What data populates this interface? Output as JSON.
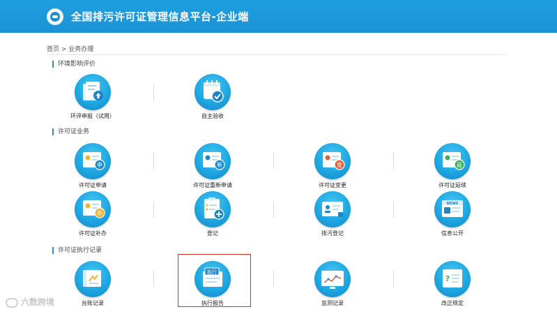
{
  "header": {
    "title": "全国排污许可证管理信息平台-企业端"
  },
  "breadcrumb": {
    "home": "首页",
    "sep": " > ",
    "current": "业务办理"
  },
  "sections": [
    {
      "title": "环境影响评价"
    },
    {
      "title": "许可证业务"
    },
    {
      "title": "许可证执行记录"
    }
  ],
  "tiles": {
    "env_report": {
      "label": "环评申报（试用）",
      "icon": "env-report-upload-icon"
    },
    "self_accept": {
      "label": "自主验收",
      "icon": "calendar-check-icon"
    },
    "permit_apply": {
      "label": "许可证申请",
      "icon": "certificate-apply-icon"
    },
    "permit_renew": {
      "label": "许可证重新申请",
      "icon": "certificate-new-icon"
    },
    "permit_change": {
      "label": "许可证变更",
      "icon": "certificate-change-icon"
    },
    "permit_extend": {
      "label": "许可证延续",
      "icon": "certificate-extend-icon"
    },
    "permit_reissue": {
      "label": "许可证补办",
      "icon": "certificate-reissue-icon"
    },
    "register": {
      "label": "登记",
      "icon": "clipboard-add-icon"
    },
    "discharge_reg": {
      "label": "排污登记",
      "icon": "id-card-icon"
    },
    "info_public": {
      "label": "信息公开",
      "icon": "news-icon"
    },
    "ledger": {
      "label": "台账记录",
      "icon": "ledger-icon"
    },
    "exec_report": {
      "label": "执行报告",
      "icon": "execute-report-icon",
      "badge": "执行"
    },
    "monitor": {
      "label": "监测记录",
      "icon": "monitor-chart-icon"
    },
    "rectify": {
      "label": "改正规定",
      "icon": "question-doc-icon",
      "badge": "?"
    }
  },
  "badges": {
    "apply": "申",
    "renew": "新",
    "change": "变",
    "extend": "延",
    "reissue": "补",
    "news": "NEWS"
  },
  "watermark": {
    "text": "六数跨境"
  },
  "colors": {
    "header": "#1a94d6",
    "circle": "#1ea7e2",
    "highlight": "#d9261c"
  }
}
